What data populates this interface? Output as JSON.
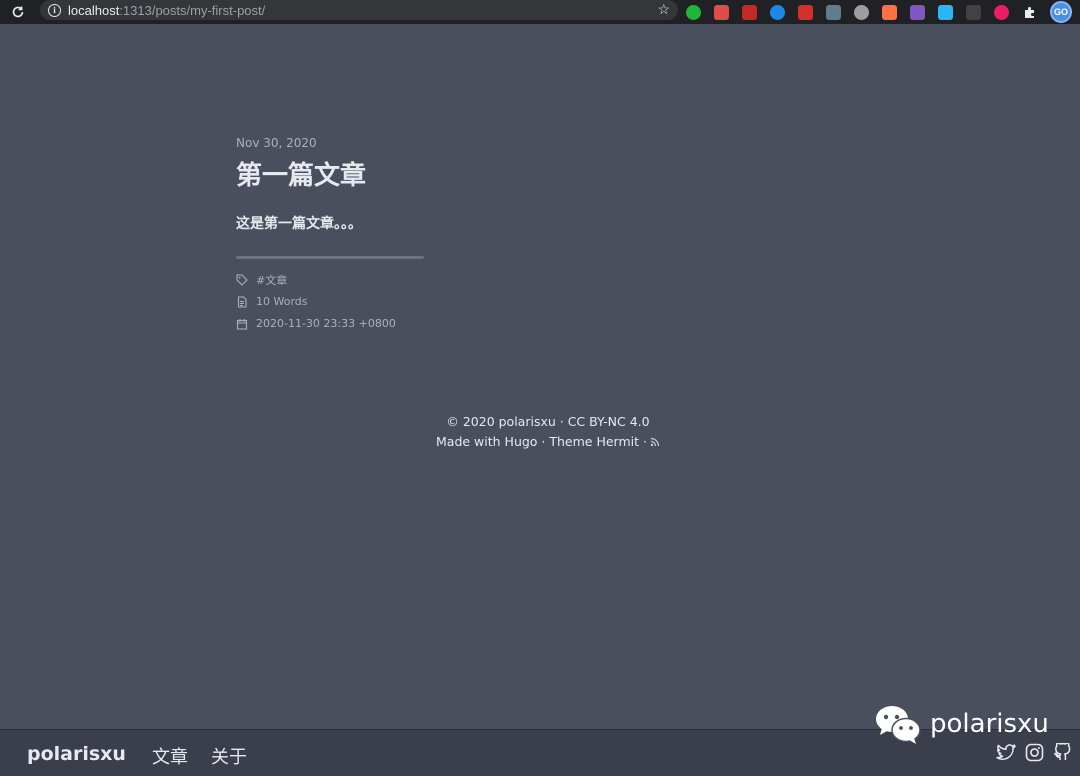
{
  "browser": {
    "url_host": "localhost",
    "url_path": ":1313/posts/my-first-post/"
  },
  "post": {
    "date": "Nov 30, 2020",
    "title": "第一篇文章",
    "body": "这是第一篇文章。。。",
    "tag": "#文章",
    "word_count": "10 Words",
    "datetime": "2020-11-30 23:33 +0800"
  },
  "footer": {
    "copyright": "© 2020 polarisxu · CC BY-NC 4.0",
    "made_with": "Made with Hugo · Theme Hermit ·"
  },
  "nav": {
    "brand": "polarisxu",
    "items": [
      {
        "label": "文章"
      },
      {
        "label": "关于"
      }
    ]
  },
  "watermark": {
    "text": "polarisxu"
  },
  "colors": {
    "background": "#494f5c",
    "nav_background": "#3a3f4b",
    "text": "#e6e9ef",
    "muted": "#a9b1c1"
  }
}
